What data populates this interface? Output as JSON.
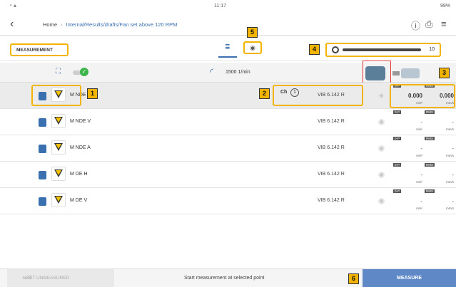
{
  "status_bar": {
    "time": "11:17",
    "battery": "99%"
  },
  "nav": {
    "home": "Home",
    "path": "Internal/Results/drafts/Fan set above 120 RPM"
  },
  "tabs": {
    "measurement": "MEASUREMENT"
  },
  "slider": {
    "value": "10",
    "fraction": 1.0
  },
  "sensor": {
    "connected": true
  },
  "speed": "1500 1/min",
  "channel": {
    "label": "Ch",
    "number": "1"
  },
  "metrics": {
    "peak_label": "0-P",
    "rms_label": "RMS",
    "peak_unit": "m/s²",
    "rms_unit": "mm/s"
  },
  "rows": [
    {
      "name": "M NDE H",
      "sensor": "VIB 6.142 R",
      "peak": "0.000",
      "rms": "0.000",
      "selected": true
    },
    {
      "name": "M NDE V",
      "sensor": "VIB 6.142 R",
      "peak": "-",
      "rms": "-"
    },
    {
      "name": "M NDE A",
      "sensor": "VIB 6.142 R",
      "peak": "-",
      "rms": "-"
    },
    {
      "name": "M DE H",
      "sensor": "VIB 6.142 R",
      "peak": "-",
      "rms": "-"
    },
    {
      "name": "M DE V",
      "sensor": "VIB 6.142 R",
      "peak": "-",
      "rms": "-"
    }
  ],
  "bottom": {
    "next_label": "NEXT UNMEASURED",
    "hint": "Start measurement at selected point",
    "measure_label": "MEASURE"
  },
  "callouts": [
    "1",
    "2",
    "3",
    "4",
    "5",
    "6"
  ],
  "colors": {
    "accent": "#f2b400",
    "primary": "#5f88c6",
    "ok": "#3cb54a"
  }
}
